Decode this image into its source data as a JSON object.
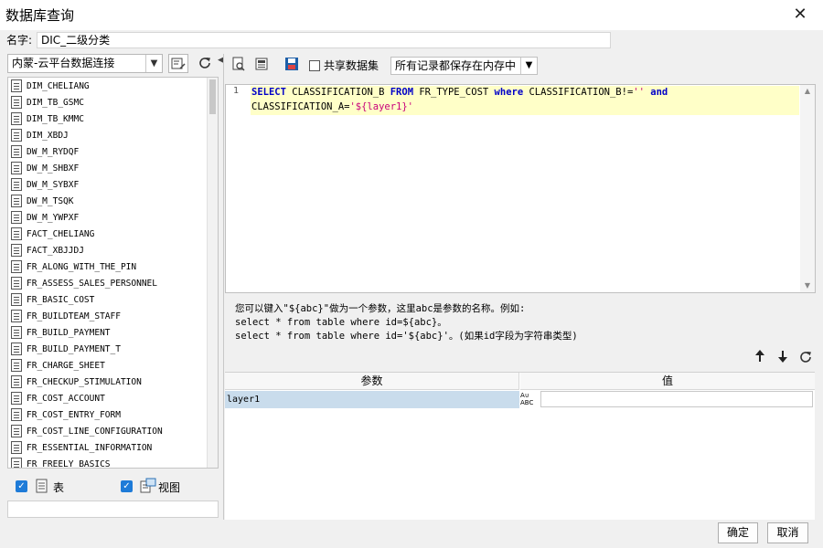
{
  "window": {
    "title": "数据库查询",
    "close_glyph": "✕"
  },
  "name_field": {
    "label": "名字:",
    "value": "DIC_二级分类"
  },
  "left_panel": {
    "connection": "内蒙-云平台数据连接",
    "tables": [
      "DIM_CHELIANG",
      "DIM_TB_GSMC",
      "DIM_TB_KMMC",
      "DIM_XBDJ",
      "DW_M_RYDQF",
      "DW_M_SHBXF",
      "DW_M_SYBXF",
      "DW_M_TSQK",
      "DW_M_YWPXF",
      "FACT_CHELIANG",
      "FACT_XBJJDJ",
      "FR_ALONG_WITH_THE_PIN",
      "FR_ASSESS_SALES_PERSONNEL",
      "FR_BASIC_COST",
      "FR_BUILDTEAM_STAFF",
      "FR_BUILD_PAYMENT",
      "FR_BUILD_PAYMENT_T",
      "FR_CHARGE_SHEET",
      "FR_CHECKUP_STIMULATION",
      "FR_COST_ACCOUNT",
      "FR_COST_ENTRY_FORM",
      "FR_COST_LINE_CONFIGURATION",
      "FR_ESSENTIAL_INFORMATION",
      "FR_FREELY_BASICS"
    ],
    "show_tables_label": "表",
    "show_views_label": "视图"
  },
  "toolbar": {
    "share_label": "共享数据集",
    "memory_option": "所有记录都保存在内存中"
  },
  "editor": {
    "line_number": "1",
    "sql_tokens": {
      "select": "SELECT",
      "t1": " CLASSIFICATION_B ",
      "from": "FROM",
      "t2": " FR_TYPE_COST ",
      "where": "where",
      "t3": " CLASSIFICATION_B!=",
      "s1": "''",
      "t4": " ",
      "and": "and",
      "line2": "CLASSIFICATION_A=",
      "s2": "'${layer1}'"
    }
  },
  "hint": {
    "line1": "您可以键入\"${abc}\"做为一个参数，这里abc是参数的名称。例如:",
    "line2": "select * from table where id=${abc}。",
    "line3": "select * from table where id='${abc}'。(如果id字段为字符串类型)"
  },
  "params": {
    "col_param": "参数",
    "col_value": "值",
    "rows": [
      {
        "name": "layer1",
        "type_icon_top": "A∪",
        "type_icon_bottom": "ABC",
        "value": ""
      }
    ]
  },
  "footer": {
    "ok_label": "确定",
    "cancel_label": "取消"
  }
}
